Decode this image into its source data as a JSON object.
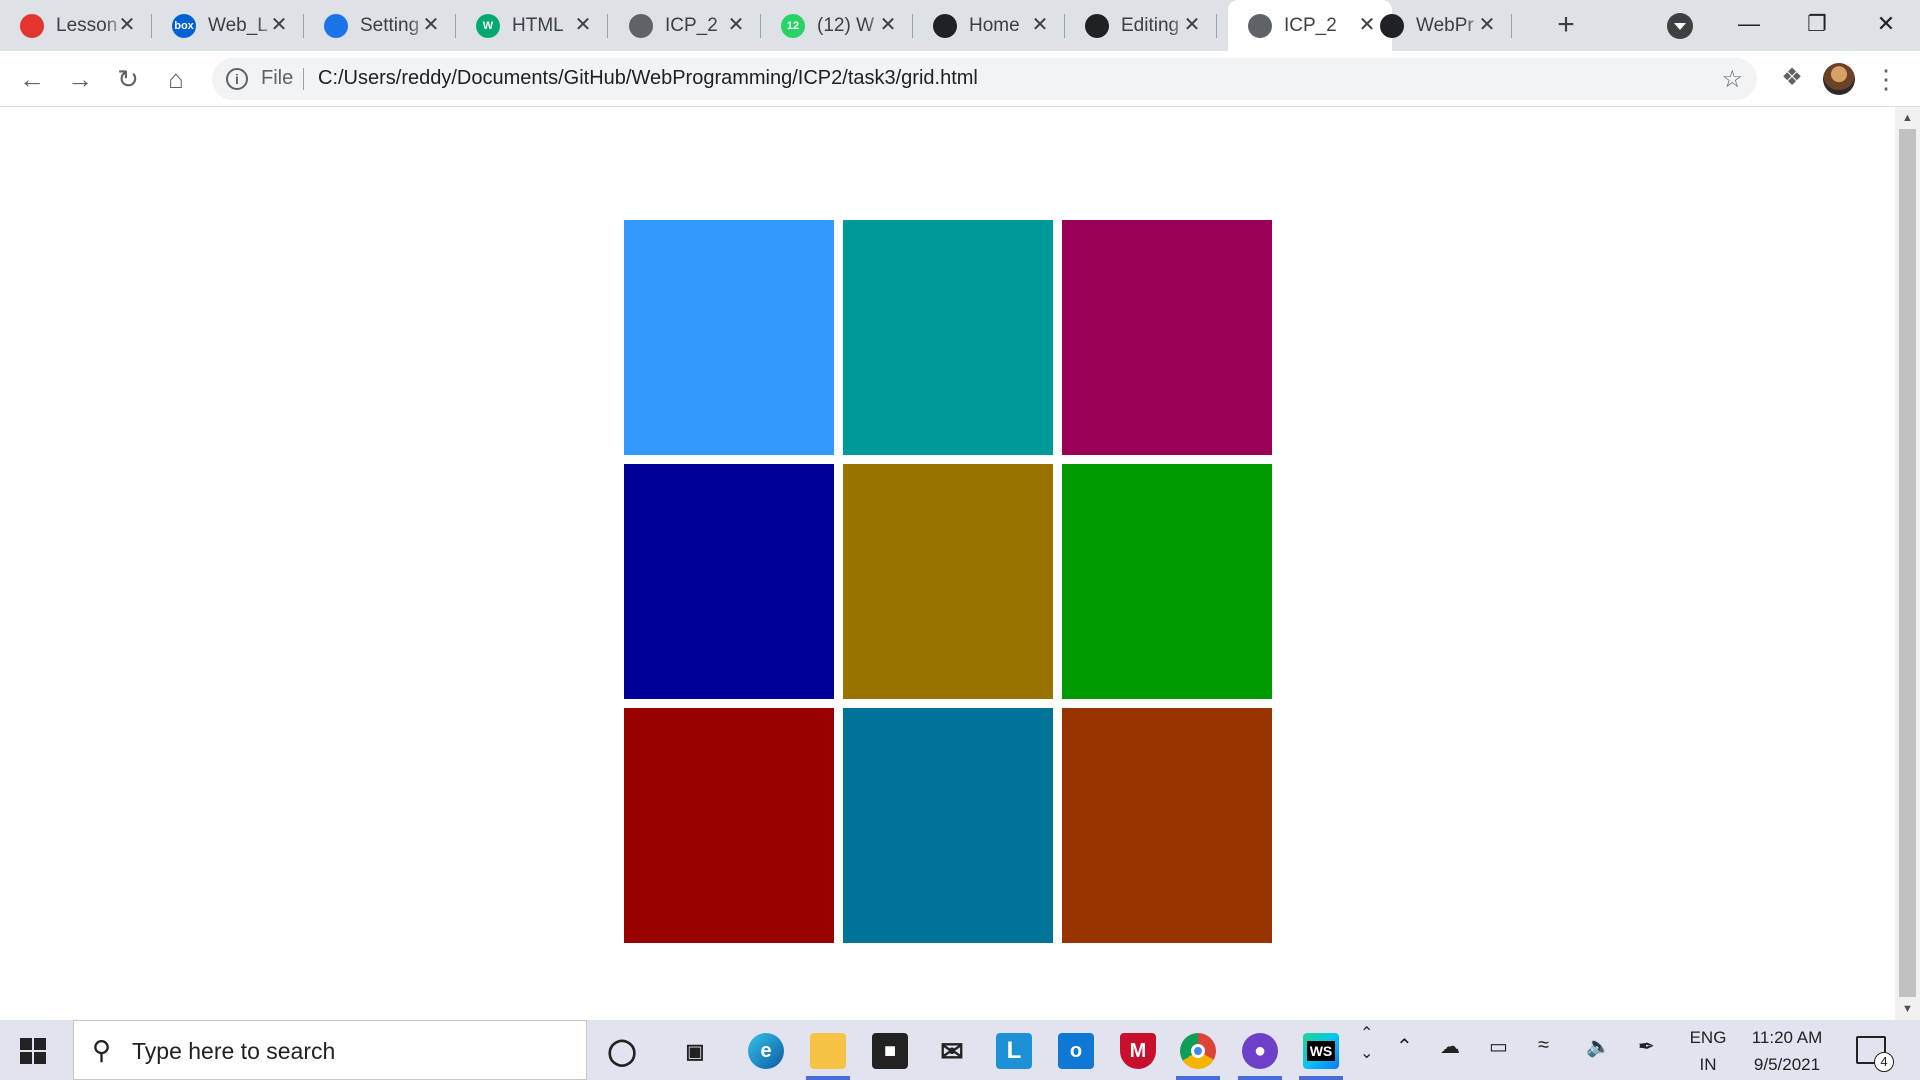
{
  "browser": {
    "tabs": [
      {
        "title": "Lesson",
        "favicon": "umkc-icon",
        "favicon_color": "#e3342f"
      },
      {
        "title": "Web_L",
        "favicon": "box-icon",
        "favicon_color": "#0061d5",
        "favicon_text": "box"
      },
      {
        "title": "Setting",
        "favicon": "gear-icon",
        "favicon_color": "#1a73e8"
      },
      {
        "title": "HTML",
        "favicon": "w3schools-icon",
        "favicon_color": "#04aa6d",
        "favicon_text": "W"
      },
      {
        "title": "ICP_2",
        "favicon": "globe-icon",
        "favicon_color": "#5f6368"
      },
      {
        "title": "(12) W",
        "favicon": "whatsapp-icon",
        "favicon_color": "#25d366",
        "favicon_text": "12"
      },
      {
        "title": "Home",
        "favicon": "github-icon",
        "favicon_color": "#202124"
      },
      {
        "title": "Editing",
        "favicon": "github-icon",
        "favicon_color": "#202124"
      },
      {
        "title": "ICP_2",
        "favicon": "globe-icon",
        "favicon_color": "#5f6368",
        "active": true
      },
      {
        "title": "WebPr",
        "favicon": "github-icon",
        "favicon_color": "#202124"
      }
    ],
    "address": {
      "scheme": "File",
      "url": "C:/Users/reddy/Documents/GitHub/WebProgramming/ICP2/task3/grid.html"
    }
  },
  "page": {
    "grid_colors": [
      "#3399ff",
      "#009999",
      "#990055",
      "#000099",
      "#997300",
      "#009900",
      "#990000",
      "#007399",
      "#993300"
    ]
  },
  "taskbar": {
    "search_placeholder": "Type here to search",
    "lang_line1": "ENG",
    "lang_line2": "IN",
    "time": "11:20 AM",
    "date": "9/5/2021",
    "notification_count": "4"
  }
}
